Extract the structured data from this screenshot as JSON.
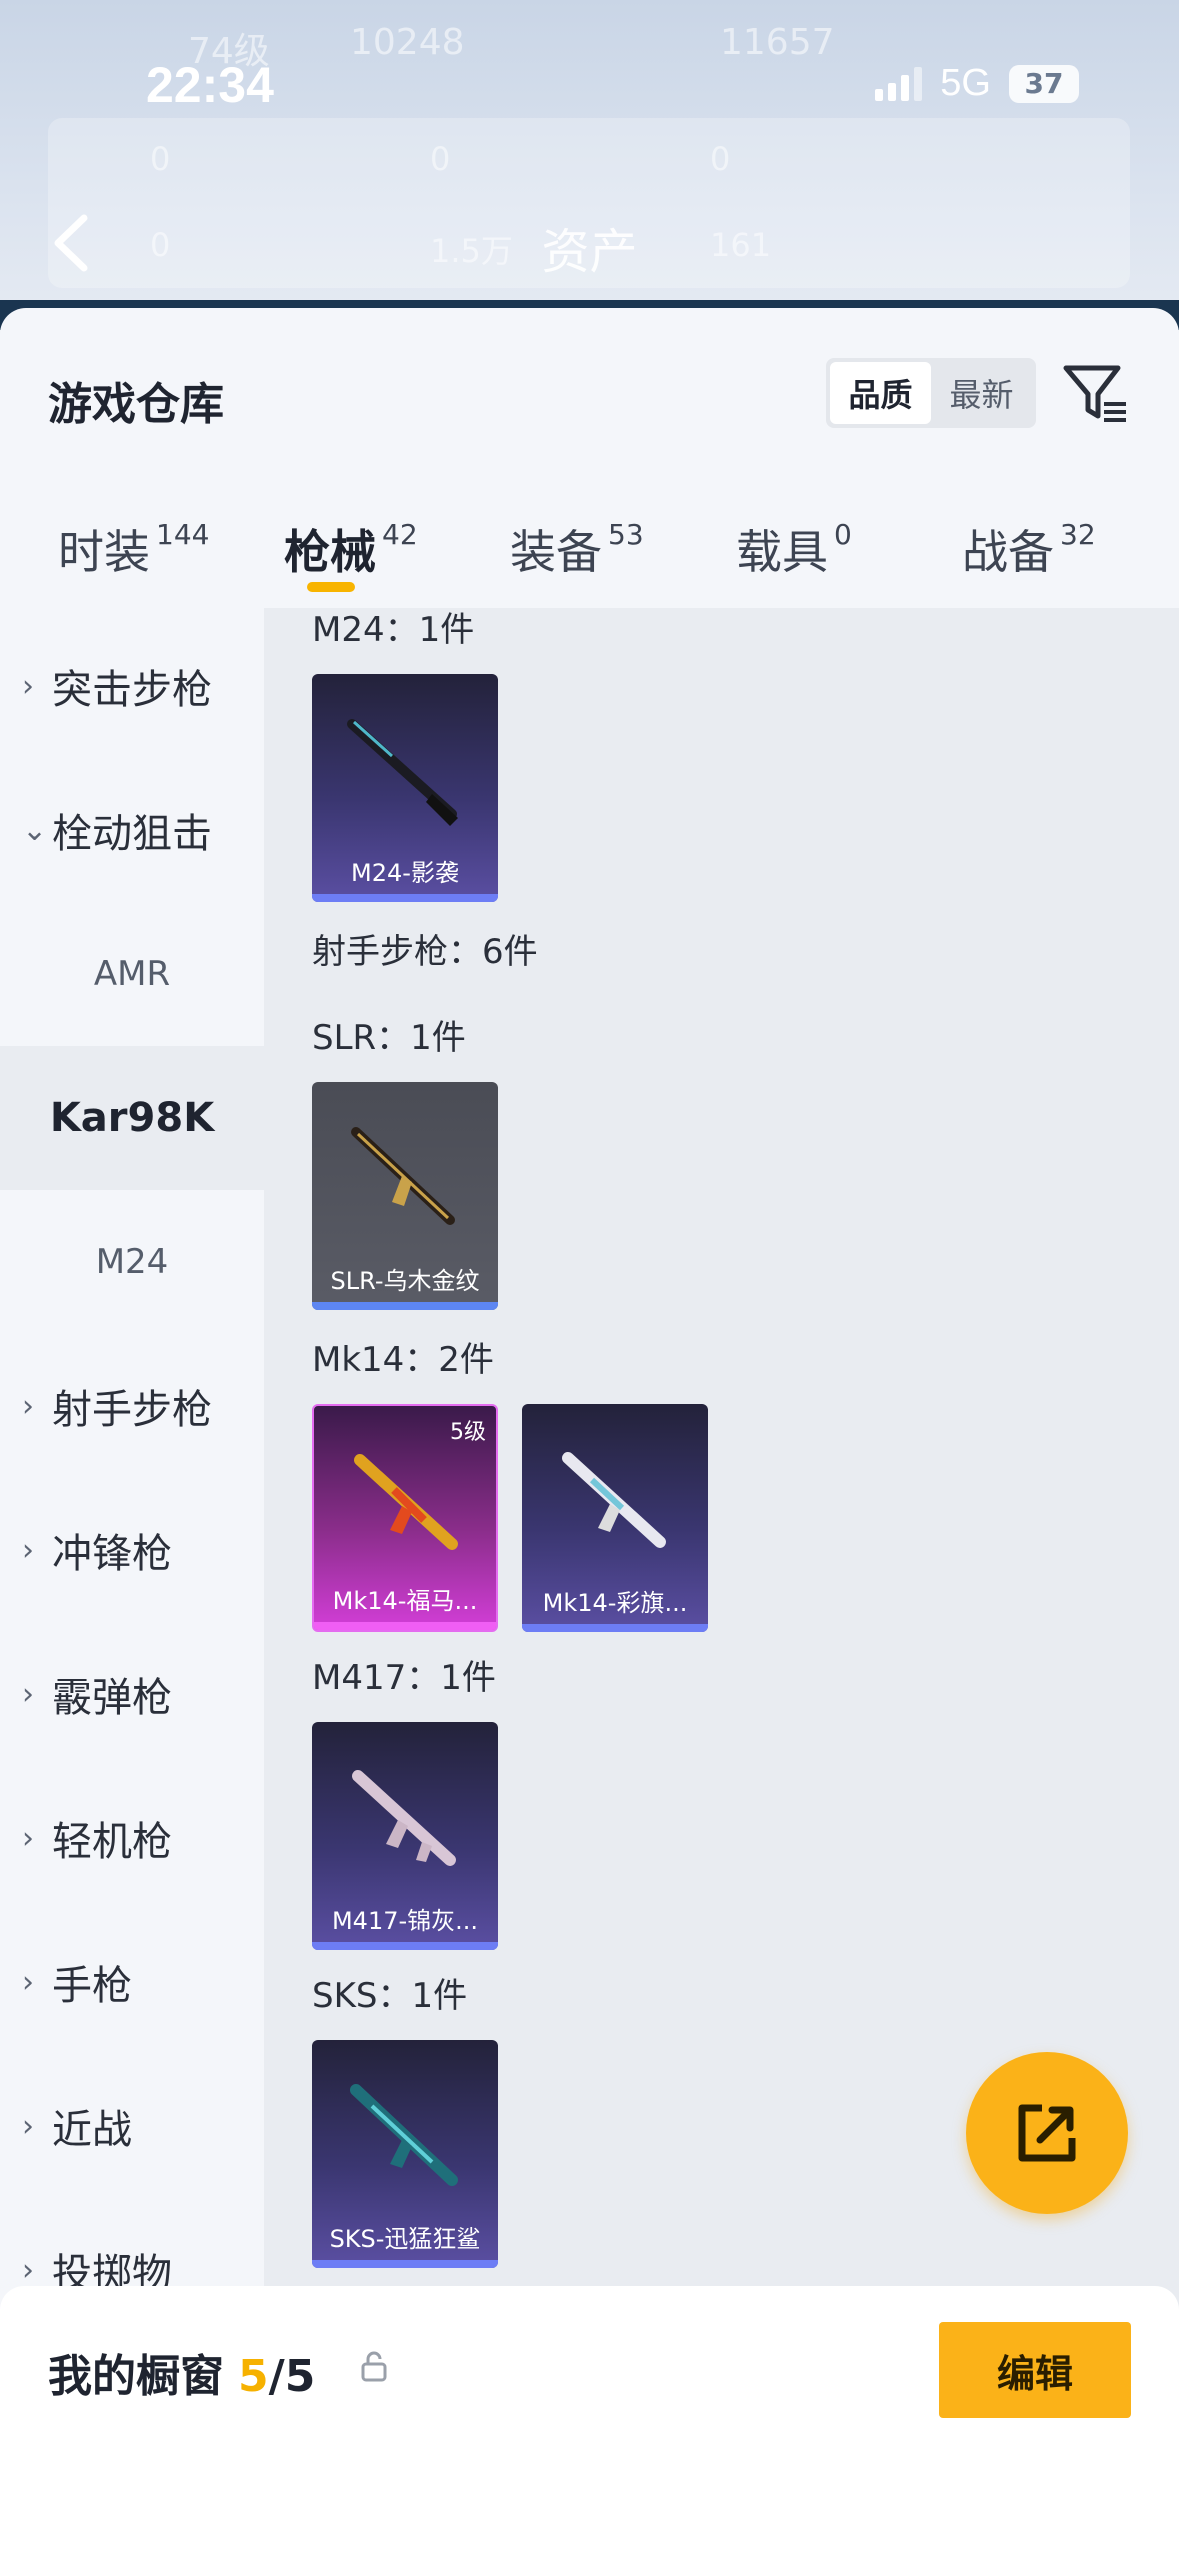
{
  "status": {
    "time": "22:34",
    "network": "5G",
    "battery": "37"
  },
  "header": {
    "title": "资产",
    "ghost_text": [
      "74级",
      "10248",
      "11657",
      "0",
      "0",
      "0",
      "0",
      "1.5万",
      "161"
    ]
  },
  "warehouse": {
    "title": "游戏仓库",
    "sort": {
      "quality": "品质",
      "newest": "最新",
      "active": "quality"
    }
  },
  "tabs": [
    {
      "label": "时装",
      "count": "144"
    },
    {
      "label": "枪械",
      "count": "42",
      "active": true
    },
    {
      "label": "装备",
      "count": "53"
    },
    {
      "label": "载具",
      "count": "0"
    },
    {
      "label": "战备",
      "count": "32"
    }
  ],
  "categories": [
    {
      "label": "突击步枪",
      "expanded": false
    },
    {
      "label": "栓动狙击",
      "expanded": true
    },
    {
      "label": "AMR",
      "sub": true
    },
    {
      "label": "Kar98K",
      "sub": true,
      "selected": true
    },
    {
      "label": "M24",
      "sub": true
    },
    {
      "label": "射手步枪",
      "expanded": false
    },
    {
      "label": "冲锋枪",
      "expanded": false
    },
    {
      "label": "霰弹枪",
      "expanded": false
    },
    {
      "label": "轻机枪",
      "expanded": false
    },
    {
      "label": "手枪",
      "expanded": false
    },
    {
      "label": "近战",
      "expanded": false
    },
    {
      "label": "投掷物",
      "expanded": false
    }
  ],
  "groups": [
    {
      "heading": "M24：1件",
      "items": [
        {
          "name": "M24-影袭",
          "rarity": "purple"
        }
      ]
    },
    {
      "heading": "射手步枪：6件",
      "items": []
    },
    {
      "heading": "SLR：1件",
      "items": [
        {
          "name": "SLR-乌木金纹",
          "rarity": "gray"
        }
      ]
    },
    {
      "heading": "Mk14：2件",
      "items": [
        {
          "name": "Mk14-福马...",
          "rarity": "pink",
          "level": "5级"
        },
        {
          "name": "Mk14-彩旗...",
          "rarity": "purple"
        }
      ]
    },
    {
      "heading": "M417：1件",
      "items": [
        {
          "name": "M417-锦灰...",
          "rarity": "purple"
        }
      ]
    },
    {
      "heading": "SKS：1件",
      "items": [
        {
          "name": "SKS-迅猛狂鲨",
          "rarity": "purple"
        }
      ]
    }
  ],
  "showcase": {
    "label": "我的橱窗",
    "current": "5",
    "rest": "/5",
    "edit_label": "编辑"
  },
  "icons": [
    "back-icon",
    "filter-icon",
    "share-icon",
    "lock-icon",
    "chevron-right-icon",
    "chevron-down-icon"
  ]
}
